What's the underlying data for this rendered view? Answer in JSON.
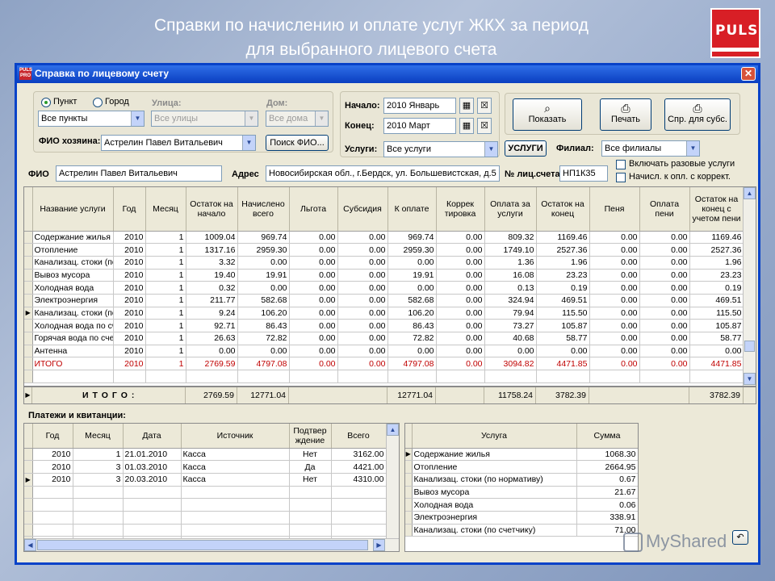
{
  "slide": {
    "title_line1": "Справки по начислению и оплате услуг ЖКХ за период",
    "title_line2": "для выбранного лицевого счета",
    "logo_text": "PULS"
  },
  "window": {
    "app_icon_text": "PULS PRO",
    "title": "Справка по лицевому счету",
    "close_symbol": "✕"
  },
  "filters": {
    "radio_punkt": "Пункт",
    "radio_gorod": "Город",
    "punkt_value": "Все пункты",
    "street_label": "Улица:",
    "street_value": "Все улицы",
    "house_label": "Дом:",
    "house_value": "Все дома",
    "owner_label": "ФИО хозяина:",
    "owner_value": "Астрелин Павел Витальевич",
    "search_fio_button": "Поиск ФИО...",
    "start_label": "Начало:",
    "start_value": "2010 Январь",
    "end_label": "Конец:",
    "end_value": "2010 Март",
    "services_label": "Услуги:",
    "services_value": "Все услуги",
    "services_button": "УСЛУГИ",
    "branch_label": "Филиал:",
    "branch_value": "Все филиалы",
    "include_onetime": "Включать разовые услуги",
    "accrued_label": "Начисл. к опл. с коррект."
  },
  "toolbar": {
    "show_button": "Показать",
    "print_button": "Печать",
    "subsidy_button": "Спр. для субс."
  },
  "account": {
    "fio_label": "ФИО",
    "fio_value": "Астрелин Павел Витальевич",
    "address_label": "Адрес",
    "address_value": "Новосибирская обл., г.Бердск, ул. Большевистская, д.5",
    "acc_label": "№ лиц.счета",
    "acc_value": "НП1К35"
  },
  "main_grid": {
    "headers": [
      "Название услуги",
      "Год",
      "Месяц",
      "Остаток на начало",
      "Начислено всего",
      "Льгота",
      "Субсидия",
      "К оплате",
      "Коррек тировка",
      "Оплата за услуги",
      "Остаток на конец",
      "Пеня",
      "Оплата пени",
      "Остаток на конец с учетом пени"
    ],
    "rows": [
      [
        "Содержание жилья",
        "2010",
        "1",
        "1009.04",
        "969.74",
        "0.00",
        "0.00",
        "969.74",
        "0.00",
        "809.32",
        "1169.46",
        "0.00",
        "0.00",
        "1169.46"
      ],
      [
        "Отопление",
        "2010",
        "1",
        "1317.16",
        "2959.30",
        "0.00",
        "0.00",
        "2959.30",
        "0.00",
        "1749.10",
        "2527.36",
        "0.00",
        "0.00",
        "2527.36"
      ],
      [
        "Канализац. стоки (по нормативу)",
        "2010",
        "1",
        "3.32",
        "0.00",
        "0.00",
        "0.00",
        "0.00",
        "0.00",
        "1.36",
        "1.96",
        "0.00",
        "0.00",
        "1.96"
      ],
      [
        "Вывоз мусора",
        "2010",
        "1",
        "19.40",
        "19.91",
        "0.00",
        "0.00",
        "19.91",
        "0.00",
        "16.08",
        "23.23",
        "0.00",
        "0.00",
        "23.23"
      ],
      [
        "Холодная вода",
        "2010",
        "1",
        "0.32",
        "0.00",
        "0.00",
        "0.00",
        "0.00",
        "0.00",
        "0.13",
        "0.19",
        "0.00",
        "0.00",
        "0.19"
      ],
      [
        "Электроэнергия",
        "2010",
        "1",
        "211.77",
        "582.68",
        "0.00",
        "0.00",
        "582.68",
        "0.00",
        "324.94",
        "469.51",
        "0.00",
        "0.00",
        "469.51"
      ],
      [
        "Канализац. стоки (по счетчику)",
        "2010",
        "1",
        "9.24",
        "106.20",
        "0.00",
        "0.00",
        "106.20",
        "0.00",
        "79.94",
        "115.50",
        "0.00",
        "0.00",
        "115.50"
      ],
      [
        "Холодная вода по счетчику",
        "2010",
        "1",
        "92.71",
        "86.43",
        "0.00",
        "0.00",
        "86.43",
        "0.00",
        "73.27",
        "105.87",
        "0.00",
        "0.00",
        "105.87"
      ],
      [
        "Горячая вода по счетчику",
        "2010",
        "1",
        "26.63",
        "72.82",
        "0.00",
        "0.00",
        "72.82",
        "0.00",
        "40.68",
        "58.77",
        "0.00",
        "0.00",
        "58.77"
      ],
      [
        "Антенна",
        "2010",
        "1",
        "0.00",
        "0.00",
        "0.00",
        "0.00",
        "0.00",
        "0.00",
        "0.00",
        "0.00",
        "0.00",
        "0.00",
        "0.00"
      ],
      [
        "ИТОГО",
        "2010",
        "1",
        "2769.59",
        "4797.08",
        "0.00",
        "0.00",
        "4797.08",
        "0.00",
        "3094.82",
        "4471.85",
        "0.00",
        "0.00",
        "4471.85"
      ],
      [
        "",
        "",
        "",
        "",
        "",
        "",
        "",
        "",
        "",
        "",
        "",
        "",
        "",
        ""
      ]
    ],
    "current_row_marker": "▶"
  },
  "totals": {
    "label": "И Т О Г О :",
    "ostatok_nachalo": "2769.59",
    "nachisleno": "12771.04",
    "k_oplate": "12771.04",
    "oplata": "11758.24",
    "ostatok_konec": "3782.39",
    "ostatok_s_peni": "3782.39"
  },
  "payments": {
    "title": "Платежи и квитанции:",
    "headers": [
      "Год",
      "Месяц",
      "Дата",
      "Источник",
      "Подтвер ждение",
      "Всего"
    ],
    "rows": [
      [
        "2010",
        "1",
        "21.01.2010",
        "Касса",
        "Нет",
        "3162.00"
      ],
      [
        "2010",
        "3",
        "01.03.2010",
        "Касса",
        "Да",
        "4421.00"
      ],
      [
        "2010",
        "3",
        "20.03.2010",
        "Касса",
        "Нет",
        "4310.00"
      ]
    ]
  },
  "payment_detail": {
    "headers": [
      "Услуга",
      "Сумма"
    ],
    "rows": [
      [
        "Содержание жилья",
        "1068.30"
      ],
      [
        "Отопление",
        "2664.95"
      ],
      [
        "Канализац. стоки (по нормативу)",
        "0.67"
      ],
      [
        "Вывоз мусора",
        "21.67"
      ],
      [
        "Холодная вода",
        "0.06"
      ],
      [
        "Электроэнергия",
        "338.91"
      ],
      [
        "Канализац. стоки (по счетчику)",
        "71.00"
      ]
    ]
  },
  "watermark": "MyShared"
}
